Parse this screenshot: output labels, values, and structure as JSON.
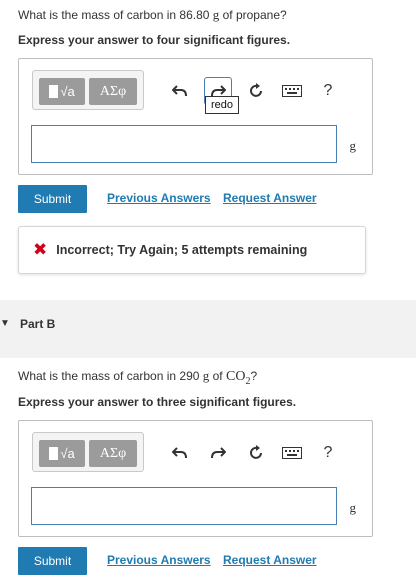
{
  "part_a": {
    "question_prefix": "What is the mass of carbon in 86.80",
    "question_unit": "g",
    "question_suffix": "of propane?",
    "instruction": "Express your answer to four significant figures.",
    "toolbar": {
      "templates_label": "√a",
      "greek_label": "AΣφ",
      "undo_icon": "undo-icon",
      "redo_icon": "redo-icon",
      "reset_icon": "reset-icon",
      "keyboard_icon": "keyboard-icon",
      "help_label": "?"
    },
    "tooltip": "redo",
    "answer_value": "",
    "unit": "g",
    "submit_label": "Submit",
    "previous_answers_label": "Previous Answers",
    "request_answer_label": "Request Answer",
    "feedback": {
      "icon": "x-icon",
      "message": "Incorrect; Try Again; 5 attempts remaining",
      "color": "#d0021b"
    }
  },
  "part_b": {
    "title": "Part B",
    "question_prefix": "What is the mass of carbon in 290",
    "question_unit": "g",
    "question_of": "of",
    "formula": "CO",
    "formula_sub": "2",
    "question_suffix": "?",
    "instruction": "Express your answer to three significant figures.",
    "toolbar": {
      "templates_label": "√a",
      "greek_label": "AΣφ",
      "help_label": "?"
    },
    "answer_value": "",
    "unit": "g",
    "submit_label": "Submit",
    "previous_answers_label": "Previous Answers",
    "request_answer_label": "Request Answer"
  },
  "colors": {
    "accent": "#1f7bb1",
    "input_border": "#4a7fb5",
    "error": "#d0021b"
  }
}
